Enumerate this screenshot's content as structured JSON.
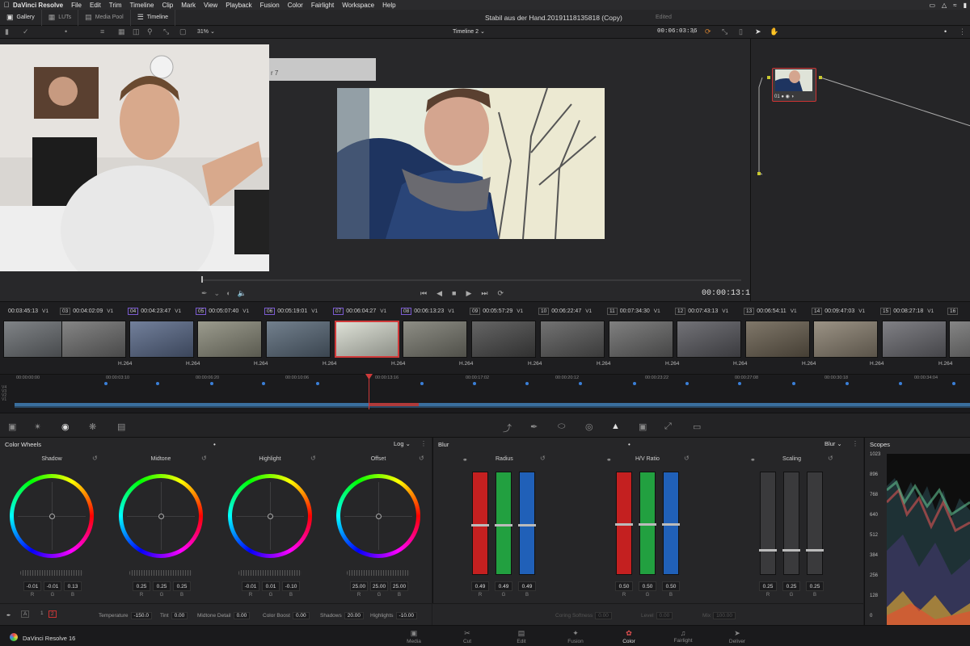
{
  "menubar": {
    "app": "DaVinci Resolve",
    "items": [
      "File",
      "Edit",
      "Trim",
      "Timeline",
      "Clip",
      "Mark",
      "View",
      "Playback",
      "Fusion",
      "Color",
      "Fairlight",
      "Workspace",
      "Help"
    ]
  },
  "toolbar": {
    "gallery": "Gallery",
    "luts": "LUTs",
    "media_pool": "Media Pool",
    "timeline": "Timeline",
    "project_title": "Stabil aus der Hand.20191118135818 (Copy)",
    "project_status": "Edited"
  },
  "viewer": {
    "zoom": "31%",
    "timeline_name": "Timeline 2",
    "source_timecode": "00:06:03:36",
    "timecode": "00:00:13:10",
    "overlay_fragment": "r 7"
  },
  "node": {
    "label": "01"
  },
  "clips": [
    {
      "num": "",
      "tc": "00:03:45:13",
      "track": "V1",
      "codec": ""
    },
    {
      "num": "03",
      "tc": "00:04:02:09",
      "track": "V1",
      "codec": "H.264"
    },
    {
      "num": "04",
      "tc": "00:04:23:47",
      "track": "V1",
      "codec": "H.264"
    },
    {
      "num": "05",
      "tc": "00:05:07:40",
      "track": "V1",
      "codec": "H.264"
    },
    {
      "num": "06",
      "tc": "00:05:19:01",
      "track": "V1",
      "codec": "H.264"
    },
    {
      "num": "07",
      "tc": "00:06:04:27",
      "track": "V1",
      "codec": "H.264"
    },
    {
      "num": "08",
      "tc": "00:06:13:23",
      "track": "V1",
      "codec": "H.264"
    },
    {
      "num": "09",
      "tc": "00:05:57:29",
      "track": "V1",
      "codec": "H.264"
    },
    {
      "num": "10",
      "tc": "00:06:22:47",
      "track": "V1",
      "codec": "H.264"
    },
    {
      "num": "11",
      "tc": "00:07:34:30",
      "track": "V1",
      "codec": "H.264"
    },
    {
      "num": "12",
      "tc": "00:07:43:13",
      "track": "V1",
      "codec": "H.264"
    },
    {
      "num": "13",
      "tc": "00:06:54:11",
      "track": "V1",
      "codec": "H.264"
    },
    {
      "num": "14",
      "tc": "00:09:47:03",
      "track": "V1",
      "codec": "H.264"
    },
    {
      "num": "15",
      "tc": "00:08:27:18",
      "track": "V1",
      "codec": "H.264"
    },
    {
      "num": "16",
      "tc": "",
      "track": "",
      "codec": ""
    }
  ],
  "ruler": [
    "00:00:00:00",
    "00:00:03:10",
    "00:00:06:20",
    "00:00:10:06",
    "00:00:13:16",
    "00:00:17:02",
    "00:00:20:12",
    "00:00:23:22",
    "00:00:27:08",
    "00:00:30:18",
    "00:00:34:04"
  ],
  "track_labels": [
    "V4",
    "V3",
    "V2",
    "V1"
  ],
  "color_wheels": {
    "title": "Color Wheels",
    "mode": "Log",
    "wheels": [
      {
        "name": "Shadow",
        "values": [
          "-0.01",
          "-0.01",
          "0.13"
        ]
      },
      {
        "name": "Midtone",
        "values": [
          "0.25",
          "0.25",
          "0.25"
        ]
      },
      {
        "name": "Highlight",
        "values": [
          "-0.01",
          "0.01",
          "-0.10"
        ]
      },
      {
        "name": "Offset",
        "values": [
          "25.00",
          "25.00",
          "25.00"
        ]
      }
    ],
    "channels": [
      "R",
      "G",
      "B"
    ],
    "footer": {
      "temperature_label": "Temperature",
      "temperature": "-150.0",
      "tint_label": "Tint",
      "tint": "0.00",
      "midtone_detail_label": "Midtone Detail",
      "midtone_detail": "0.00",
      "color_boost_label": "Color Boost",
      "color_boost": "0.00",
      "shadows_label": "Shadows",
      "shadows": "20.00",
      "highlights_label": "Highlights",
      "highlights": "-10.00",
      "page_a": "A",
      "page_1": "1",
      "page_2": "2"
    }
  },
  "blur": {
    "title": "Blur",
    "mode": "Blur",
    "groups": [
      {
        "name": "Radius",
        "values": [
          "0.49",
          "0.49",
          "0.49"
        ]
      },
      {
        "name": "H/V Ratio",
        "values": [
          "0.50",
          "0.50",
          "0.50"
        ]
      },
      {
        "name": "Scaling",
        "values": [
          "0.25",
          "0.25",
          "0.25"
        ]
      }
    ],
    "levels": [
      0.49,
      0.5,
      0.25
    ],
    "channels": [
      "R",
      "G",
      "B"
    ],
    "footer": {
      "coring_label": "Coring Softness",
      "coring": "0.00",
      "level_label": "Level",
      "level": "0.00",
      "mix_label": "Mix",
      "mix": "100.00"
    }
  },
  "scopes": {
    "title": "Scopes",
    "labels": [
      "1023",
      "896",
      "768",
      "640",
      "512",
      "384",
      "256",
      "128",
      "0"
    ]
  },
  "bottom_nav": {
    "brand": "DaVinci Resolve 16",
    "items": [
      "Media",
      "Cut",
      "Edit",
      "Fusion",
      "Color",
      "Fairlight",
      "Deliver"
    ],
    "active": "Color"
  },
  "colors": {
    "accent": "#d03a3a",
    "selection": "#7a5ad0",
    "marker": "#3a7fd8"
  }
}
